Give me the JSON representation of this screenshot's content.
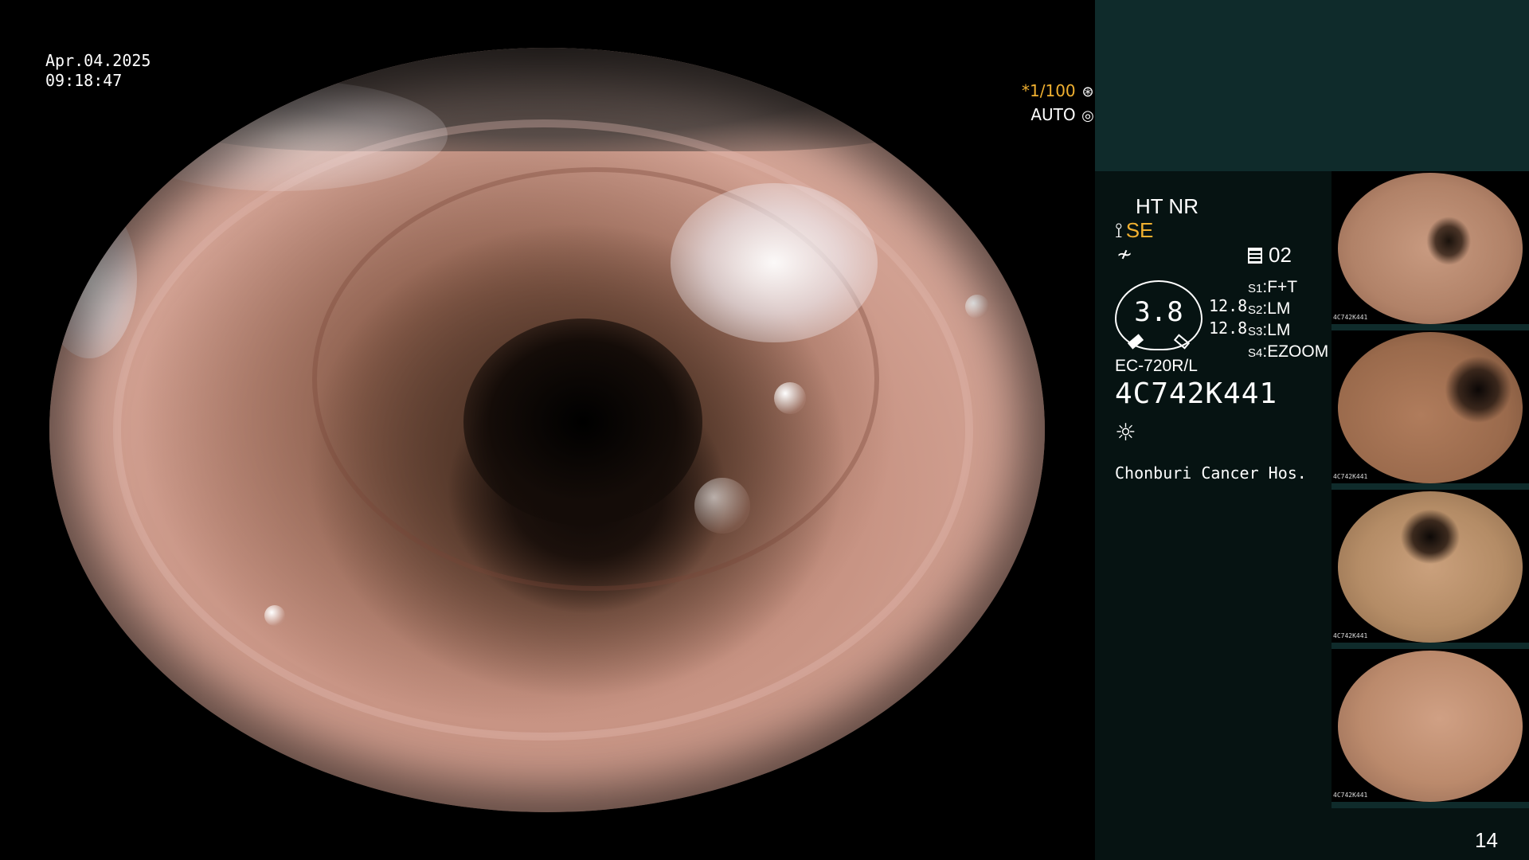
{
  "scope": {
    "date": "Apr.04.2025",
    "time": "09:18:47",
    "shutter_prefix": "*",
    "shutter": "1/100",
    "iris_mode": "AUTO"
  },
  "panel": {
    "ht_nr": "HT NR",
    "se": "SE",
    "memory": "02",
    "gauge_value": "3.8",
    "readout_1": "12.8",
    "readout_2": "12.8",
    "switches": [
      {
        "key": "S1",
        "value": "F+T"
      },
      {
        "key": "S2",
        "value": "LM"
      },
      {
        "key": "S3",
        "value": "LM"
      },
      {
        "key": "S4",
        "value": "EZOOM"
      }
    ],
    "scope_model": "EC-720R/L",
    "serial": "4C742K441",
    "hospital": "Chonburi Cancer Hos."
  },
  "thumbnails": [
    {
      "serial": "4C742K441"
    },
    {
      "serial": "4C742K441"
    },
    {
      "serial": "4C742K441"
    },
    {
      "serial": "4C742K441"
    }
  ],
  "page_number": "14",
  "icons": {
    "shutter": "aperture-icon",
    "iris": "iris-icon",
    "se": "structure-enhance-icon",
    "wave": "wave-icon",
    "memory": "memory-icon",
    "light": "light-icon"
  },
  "colors": {
    "accent": "#f0b030",
    "panel_top": "#0f2b2b",
    "panel": "#061312"
  }
}
